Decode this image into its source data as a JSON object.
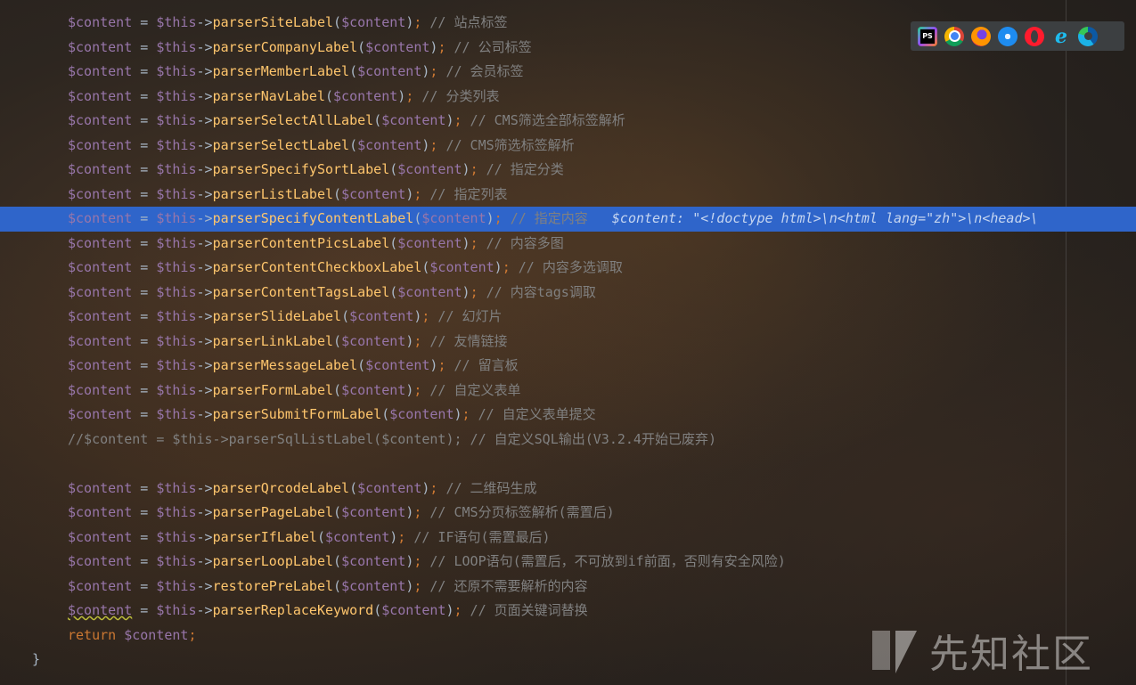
{
  "code": {
    "lines": [
      {
        "fn": "parserSiteLabel",
        "comment": "// 站点标签"
      },
      {
        "fn": "parserCompanyLabel",
        "comment": "// 公司标签"
      },
      {
        "fn": "parserMemberLabel",
        "comment": "// 会员标签"
      },
      {
        "fn": "parserNavLabel",
        "comment": "// 分类列表"
      },
      {
        "fn": "parserSelectAllLabel",
        "comment": "// CMS筛选全部标签解析"
      },
      {
        "fn": "parserSelectLabel",
        "comment": "// CMS筛选标签解析"
      },
      {
        "fn": "parserSpecifySortLabel",
        "comment": "// 指定分类"
      },
      {
        "fn": "parserListLabel",
        "comment": "// 指定列表"
      },
      {
        "fn": "parserSpecifyContentLabel",
        "comment": "// 指定内容",
        "hint": "$content: \"<!doctype html>\\n<html lang=\"zh\">\\n<head>\\"
      },
      {
        "fn": "parserContentPicsLabel",
        "comment": "// 内容多图"
      },
      {
        "fn": "parserContentCheckboxLabel",
        "comment": "// 内容多选调取"
      },
      {
        "fn": "parserContentTagsLabel",
        "comment": "// 内容tags调取"
      },
      {
        "fn": "parserSlideLabel",
        "comment": "// 幻灯片"
      },
      {
        "fn": "parserLinkLabel",
        "comment": "// 友情链接"
      },
      {
        "fn": "parserMessageLabel",
        "comment": "// 留言板"
      },
      {
        "fn": "parserFormLabel",
        "comment": "// 自定义表单"
      },
      {
        "fn": "parserSubmitFormLabel",
        "comment": "// 自定义表单提交"
      },
      {
        "raw": "//$content = $this->parserSqlListLabel($content); // 自定义SQL输出(V3.2.4开始已废弃)"
      },
      {
        "blank": ""
      },
      {
        "fn": "parserQrcodeLabel",
        "comment": "// 二维码生成"
      },
      {
        "fn": "parserPageLabel",
        "comment": "// CMS分页标签解析(需置后)"
      },
      {
        "fn": "parserIfLabel",
        "comment": "// IF语句(需置最后)"
      },
      {
        "fn": "parserLoopLabel",
        "comment": "// LOOP语句(需置后，不可放到if前面，否则有安全风险)"
      },
      {
        "fn": "restorePreLabel",
        "comment": "// 还原不需要解析的内容"
      },
      {
        "fn": "parserReplaceKeyword",
        "comment": "// 页面关键词替换"
      }
    ],
    "var_name": "$content",
    "this_name": "$this",
    "arrow": "->",
    "assign": " = ",
    "return_kw": "return",
    "closing_brace": "}"
  },
  "browser_icons": [
    "phpstorm-icon",
    "chrome-icon",
    "firefox-icon",
    "safari-icon",
    "opera-icon",
    "ie-icon",
    "edge-icon"
  ],
  "ps_label": "PS",
  "ie_label": "e",
  "watermark": {
    "text": "先知社区"
  },
  "colors": {
    "highlight": "#2f65ca",
    "variable": "#9876aa",
    "keyword": "#cc7832",
    "function": "#ffc66d",
    "comment": "#808080",
    "text": "#a9b7c6"
  }
}
